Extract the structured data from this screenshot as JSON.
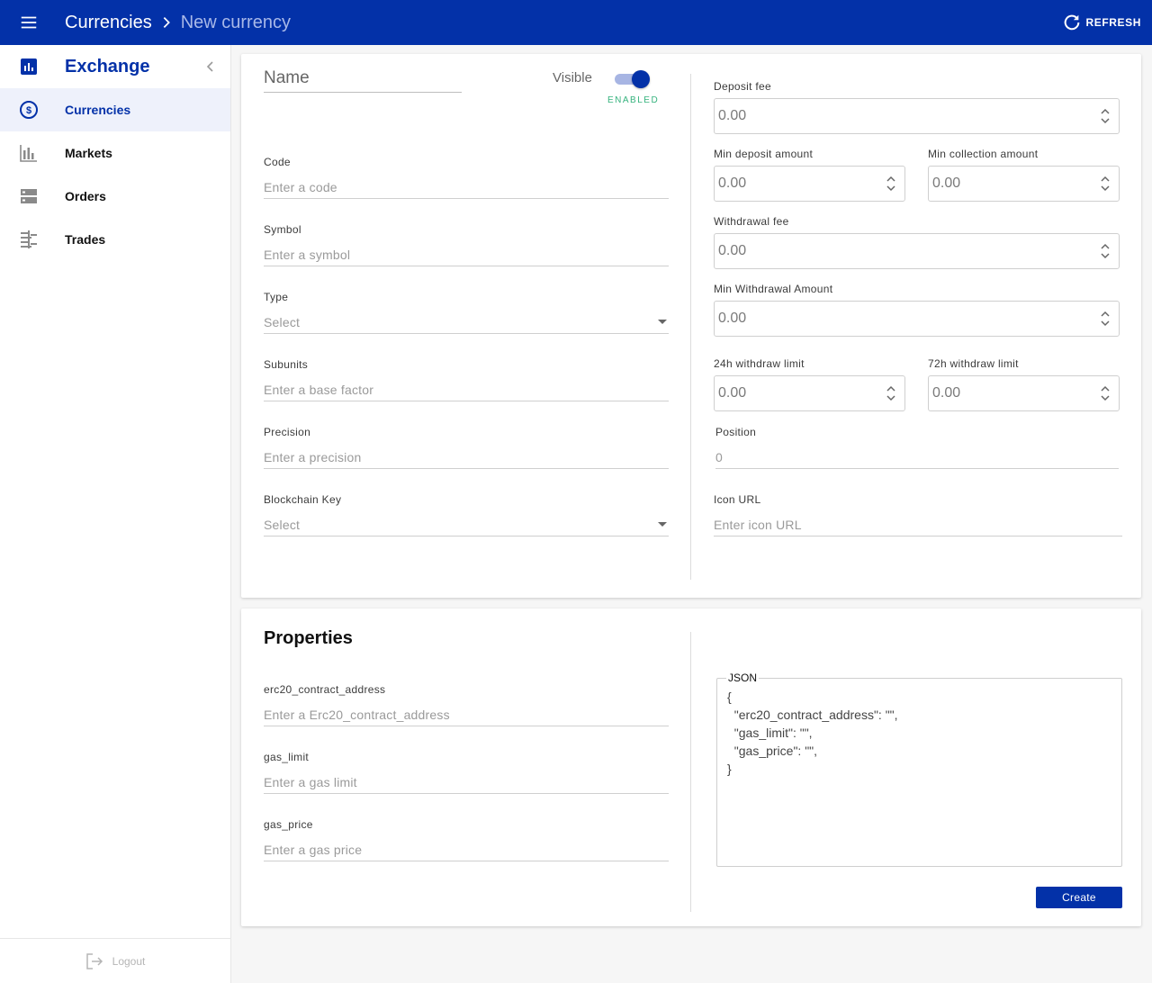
{
  "header": {
    "breadcrumb_parent": "Currencies",
    "breadcrumb_current": "New currency",
    "refresh_label": "REFRESH",
    "bar_color": "#0331a8"
  },
  "sidebar": {
    "title": "Exchange",
    "items": [
      {
        "label": "Currencies",
        "icon": "dollar-circle-icon",
        "active": true
      },
      {
        "label": "Markets",
        "icon": "bar-chart-icon",
        "active": false
      },
      {
        "label": "Orders",
        "icon": "orders-icon",
        "active": false
      },
      {
        "label": "Trades",
        "icon": "trades-icon",
        "active": false
      }
    ],
    "logout_label": "Logout"
  },
  "form": {
    "name_placeholder": "Name",
    "visible_label": "Visible",
    "visible_state": "ENABLED",
    "left_fields": [
      {
        "label": "Code",
        "placeholder": "Enter a code"
      },
      {
        "label": "Symbol",
        "placeholder": "Enter a symbol"
      },
      {
        "label": "Type",
        "placeholder": "Select"
      },
      {
        "label": "Subunits",
        "placeholder": "Enter a base factor"
      },
      {
        "label": "Precision",
        "placeholder": "Enter a precision"
      },
      {
        "label": "Blockchain Key",
        "placeholder": "Select"
      }
    ],
    "deposit_fee": {
      "label": "Deposit fee",
      "value": "0.00"
    },
    "min_deposit_amount": {
      "label": "Min deposit amount",
      "value": "0.00"
    },
    "min_collection_amount": {
      "label": "Min collection amount",
      "value": "0.00"
    },
    "withdrawal_fee": {
      "label": "Withdrawal fee",
      "value": "0.00"
    },
    "min_withdrawal_amount": {
      "label": "Min Withdrawal Amount",
      "value": "0.00"
    },
    "withdraw_limit_24h": {
      "label": "24h withdraw limit",
      "value": "0.00"
    },
    "withdraw_limit_72h": {
      "label": "72h withdraw limit",
      "value": "0.00"
    },
    "position": {
      "label": "Position",
      "placeholder": "0"
    },
    "icon_url": {
      "label": "Icon URL",
      "placeholder": "Enter icon URL"
    }
  },
  "properties": {
    "title": "Properties",
    "fields": [
      {
        "label": "erc20_contract_address",
        "placeholder": "Enter a Erc20_contract_address"
      },
      {
        "label": "gas_limit",
        "placeholder": "Enter a gas limit"
      },
      {
        "label": "gas_price",
        "placeholder": "Enter a gas price"
      }
    ],
    "json_legend": "JSON",
    "json_text": "{\n  \"erc20_contract_address\": \"\",\n  \"gas_limit\": \"\",\n  \"gas_price\": \"\",\n}",
    "create_label": "Create"
  }
}
